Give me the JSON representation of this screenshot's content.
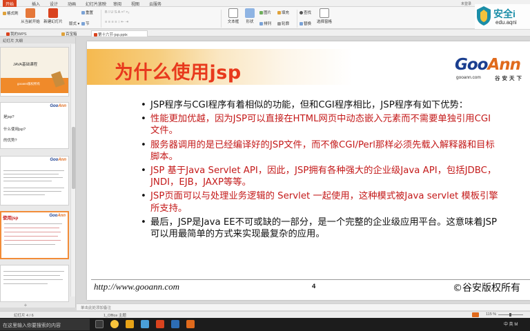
{
  "ribbon": {
    "tabs": [
      "开始",
      "插入",
      "设计",
      "动画",
      "幻灯片放映",
      "审阅",
      "视图",
      "云服务"
    ],
    "active_tab": "开始",
    "user": "未登录",
    "groups": {
      "format_painter": "格式刷",
      "from_current": "从当前开始",
      "new_slide": "新建幻灯片",
      "layout": "版式",
      "reset": "重置",
      "section": "节",
      "textbox": "文本框",
      "shape": "形状",
      "arrange": "排列",
      "picture": "图片",
      "fill": "填充",
      "outline": "轮廓",
      "find": "查找",
      "replace": "替换",
      "select_pane": "选择窗格"
    }
  },
  "brand": {
    "title": "安全i",
    "url": "edu.aqni"
  },
  "doc_tabs": [
    "我的WPS",
    "百宝箱",
    "第十六节-jsp.pptx"
  ],
  "left_pane": {
    "tabs": "幻灯片  大纲",
    "thumb1": {
      "line1": "JAVA基础课程",
      "line2": "gooann版权所有"
    },
    "thumb2": {
      "items": [
        "是jsp?",
        "什么使用jsp?",
        "的优势?"
      ]
    },
    "thumb4": {
      "title": "使用jsp"
    }
  },
  "slide": {
    "title": "为什么使用jsp",
    "logo": {
      "goo": "Goo",
      "ann": "Ann",
      "url": "gooann.com",
      "cn": "谷安天下"
    },
    "bullets": [
      {
        "text": "JSP程序与CGI程序有着相似的功能，但和CGI程序相比，JSP程序有如下优势：",
        "red": false
      },
      {
        "text": "性能更加优越，因为JSP可以直接在HTML网页中动态嵌入元素而不需要单独引用CGI文件。",
        "red": true
      },
      {
        "text": "服务器调用的是已经编译好的JSP文件，而不像CGI/Perl那样必须先载入解释器和目标脚本。",
        "red": true
      },
      {
        "text": "JSP 基于Java Servlet API，因此，JSP拥有各种强大的企业级Java API，包括JDBC，JNDI，EJB，JAXP等等。",
        "red": true
      },
      {
        "text": "JSP页面可以与处理业务逻辑的 Servlet 一起使用，这种模式被Java servlet 模板引擎所支持。",
        "red": true
      },
      {
        "text": "最后，JSP是Java EE不可或缺的一部分，是一个完整的企业级应用平台。这意味着JSP可以用最简单的方式来实现最复杂的应用。",
        "red": false
      }
    ],
    "footer_url": "http://www.gooann.com",
    "page_number": "4",
    "copyright": "©谷安版权所有"
  },
  "notes_placeholder": "单击此处添加备注",
  "status": {
    "slide_counter": "幻灯片 4 / 6",
    "theme": "1_Office 主题",
    "zoom": "115 %"
  },
  "taskbar": {
    "search_placeholder": "在这里输入你要搜索的内容",
    "tray": "中 英  M"
  },
  "colors": {
    "accent": "#d9431e",
    "title_red": "#e8391d",
    "bullet_red": "#c41a1a",
    "goo_blue": "#1a3e8f",
    "ann_orange": "#e06a1c"
  }
}
